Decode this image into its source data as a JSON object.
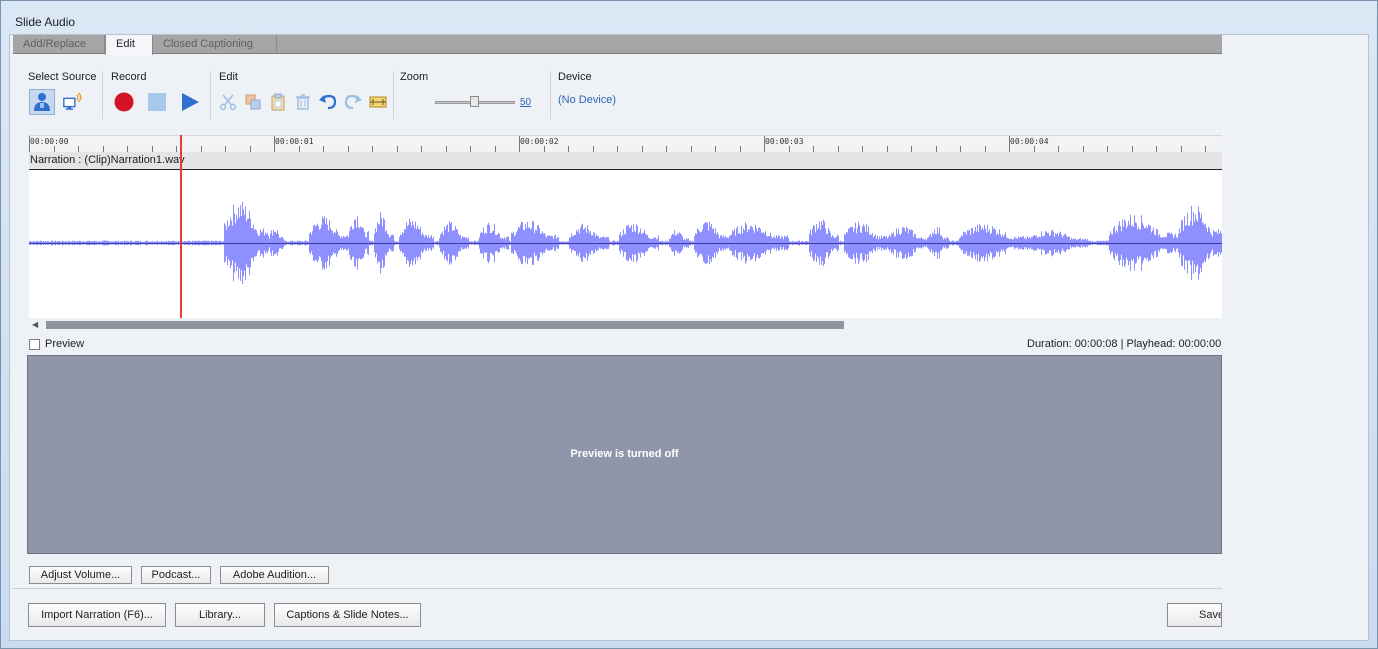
{
  "window": {
    "title": "Slide Audio"
  },
  "tabs": [
    {
      "label": "Add/Replace",
      "active": false
    },
    {
      "label": "Edit",
      "active": true
    },
    {
      "label": "Closed Captioning",
      "active": false
    }
  ],
  "toolbar": {
    "select_source_label": "Select Source",
    "record_label": "Record",
    "edit_label": "Edit",
    "zoom_label": "Zoom",
    "zoom_value": "50",
    "device_label": "Device",
    "device_value": "(No Device)"
  },
  "timeline": {
    "ticks": [
      "00:00:00",
      "00:00:01",
      "00:00:02",
      "00:00:03",
      "00:00:04"
    ],
    "track_label": "Narration : (Clip)Narration1.wav"
  },
  "preview": {
    "checkbox_label": "Preview",
    "checked": false,
    "status_text": "Duration:  00:00:08  | Playhead:  00:00:00",
    "message": "Preview is turned off"
  },
  "buttons": {
    "adjust_volume": "Adjust Volume...",
    "podcast": "Podcast...",
    "adobe_audition": "Adobe Audition...",
    "import_narration": "Import Narration (F6)...",
    "library": "Library...",
    "captions_slide_notes": "Captions & Slide Notes...",
    "save": "Save"
  },
  "colors": {
    "waveform": "#8f90ff",
    "playhead": "#e8393b",
    "record": "#d21424",
    "accent": "#2a66b8"
  }
}
